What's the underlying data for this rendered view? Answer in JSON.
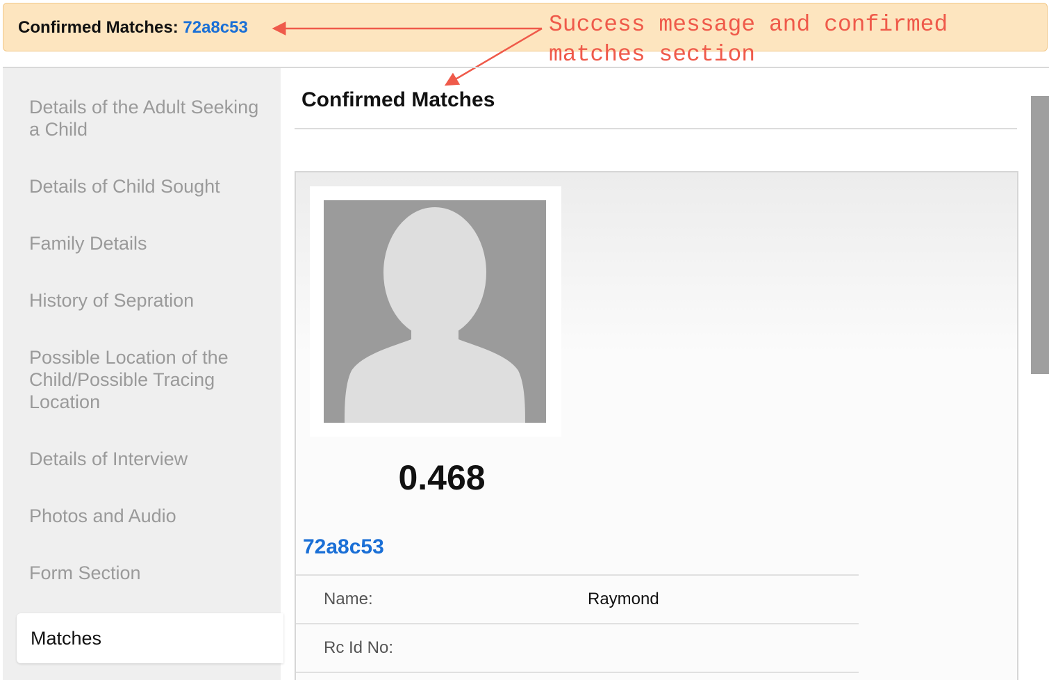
{
  "flash": {
    "label": "Confirmed Matches: ",
    "match_id": "72a8c53"
  },
  "annotation": {
    "line1": "Success message and confirmed",
    "line2": "matches section",
    "color": "#ef5a4a"
  },
  "sidebar": {
    "items": [
      {
        "label": "Details of the Adult Seeking a Child"
      },
      {
        "label": "Details of Child Sought"
      },
      {
        "label": "Family Details"
      },
      {
        "label": "History of Sepration"
      },
      {
        "label": "Possible Location of the Child/Possible Tracing Location"
      },
      {
        "label": "Details of Interview"
      },
      {
        "label": "Photos and Audio"
      },
      {
        "label": "Form Section"
      }
    ],
    "active": {
      "label": "Matches"
    }
  },
  "main": {
    "title": "Confirmed Matches",
    "match": {
      "photo_icon": "person-silhouette-icon",
      "score": "0.468",
      "id": "72a8c53",
      "fields": [
        {
          "label": "Name:",
          "value": "Raymond"
        },
        {
          "label": "Rc Id No:",
          "value": ""
        }
      ]
    }
  },
  "colors": {
    "link": "#1a6fd6",
    "flash_bg": "#fde5bf",
    "sidebar_bg": "#efefef"
  }
}
